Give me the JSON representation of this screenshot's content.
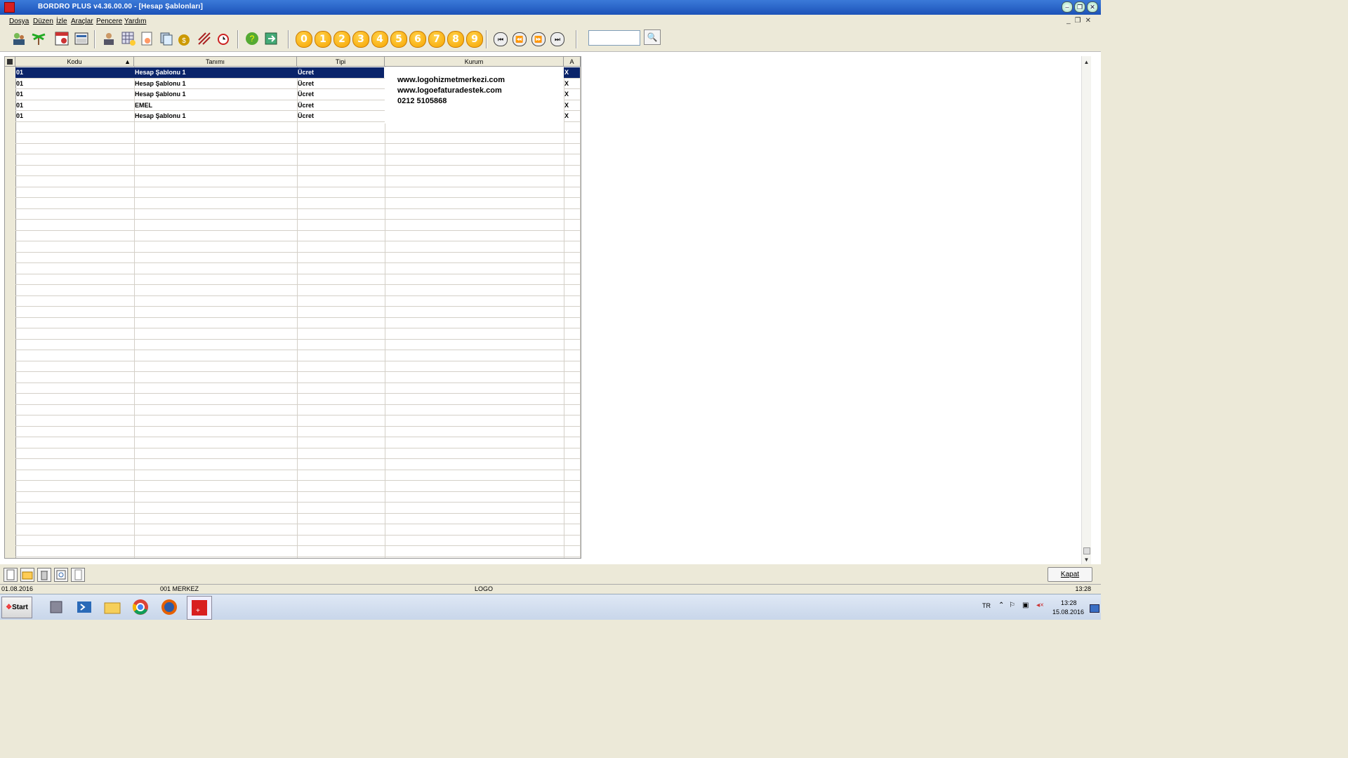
{
  "window": {
    "title": "BORDRO PLUS v4.36.00.00 - [Hesap Şablonları]",
    "controls": [
      "–",
      "❐",
      "✕"
    ],
    "inner_controls": [
      "_",
      "❐",
      "✕"
    ]
  },
  "menu": [
    "Dosya",
    "Düzen",
    "İzle",
    "Araçlar",
    "Pencere",
    "Yardım"
  ],
  "toolbar": {
    "numbers": [
      "0",
      "1",
      "2",
      "3",
      "4",
      "5",
      "6",
      "7",
      "8",
      "9"
    ],
    "nav": [
      "⏮",
      "⏪",
      "⏩",
      "⏭"
    ],
    "search_value": "",
    "search_icon": "magnifier-icon"
  },
  "grid": {
    "columns": [
      "Kodu",
      "Tanımı",
      "Tipi",
      "Kurum",
      "A"
    ],
    "sort_indicator": "▲",
    "rows": [
      {
        "kodu": "01",
        "tanimi": "Hesap Şablonu 1",
        "tipi": "Ücret",
        "a": "X"
      },
      {
        "kodu": "01",
        "tanimi": "Hesap Şablonu 1",
        "tipi": "Ücret",
        "a": "X"
      },
      {
        "kodu": "01",
        "tanimi": "Hesap Şablonu 1",
        "tipi": "Ücret",
        "a": "X"
      },
      {
        "kodu": "01",
        "tanimi": "EMEL",
        "tipi": "Ücret",
        "a": "X"
      },
      {
        "kodu": "01",
        "tanimi": "Hesap Şablonu 1",
        "tipi": "Ücret",
        "a": "X"
      }
    ],
    "overlay_lines": [
      "www.logohizmetmerkezi.com",
      "www.logoefaturadestek.com",
      "0212 5105868"
    ]
  },
  "bottom": {
    "close_label": "Kapat"
  },
  "status": {
    "date": "01.08.2016",
    "branch": "001 MERKEZ",
    "center": "LOGO",
    "time": "13:28"
  },
  "taskbar": {
    "start": "Start",
    "lang": "TR",
    "clock_time": "13:28",
    "clock_date": "15.08.2016"
  },
  "colors": {
    "selection": "#0a246a",
    "number_button": "#f7a400"
  }
}
